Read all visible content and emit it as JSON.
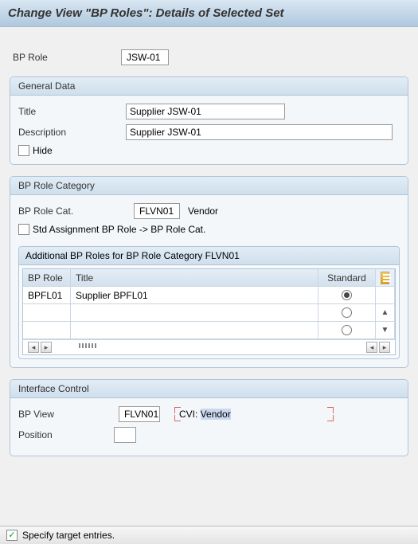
{
  "title": "Change View \"BP Roles\": Details of Selected Set",
  "top": {
    "bp_role_label": "BP Role",
    "bp_role_value": "JSW-01"
  },
  "general": {
    "header": "General Data",
    "title_label": "Title",
    "title_value": "Supplier JSW-01",
    "desc_label": "Description",
    "desc_value": "Supplier JSW-01",
    "hide_label": "Hide",
    "hide_checked": false
  },
  "category": {
    "header": "BP Role Category",
    "cat_label": "BP Role Cat.",
    "cat_value": "FLVN01",
    "cat_text": "Vendor",
    "std_assign_label": "Std Assignment BP Role -> BP Role Cat.",
    "std_assign_checked": false,
    "sub_header": "Additional BP Roles for BP Role Category FLVN01",
    "columns": {
      "role": "BP Role",
      "title": "Title",
      "std": "Standard"
    },
    "rows": [
      {
        "role": "BPFL01",
        "title": "Supplier BPFL01",
        "std": true
      },
      {
        "role": "",
        "title": "",
        "std": false
      },
      {
        "role": "",
        "title": "",
        "std": false
      }
    ]
  },
  "interface": {
    "header": "Interface Control",
    "view_label": "BP View",
    "view_value": "FLVN01",
    "cvi_prefix": "CVI: ",
    "cvi_value": "Vendor",
    "pos_label": "Position",
    "pos_value": ""
  },
  "status": {
    "text": "Specify target entries."
  }
}
